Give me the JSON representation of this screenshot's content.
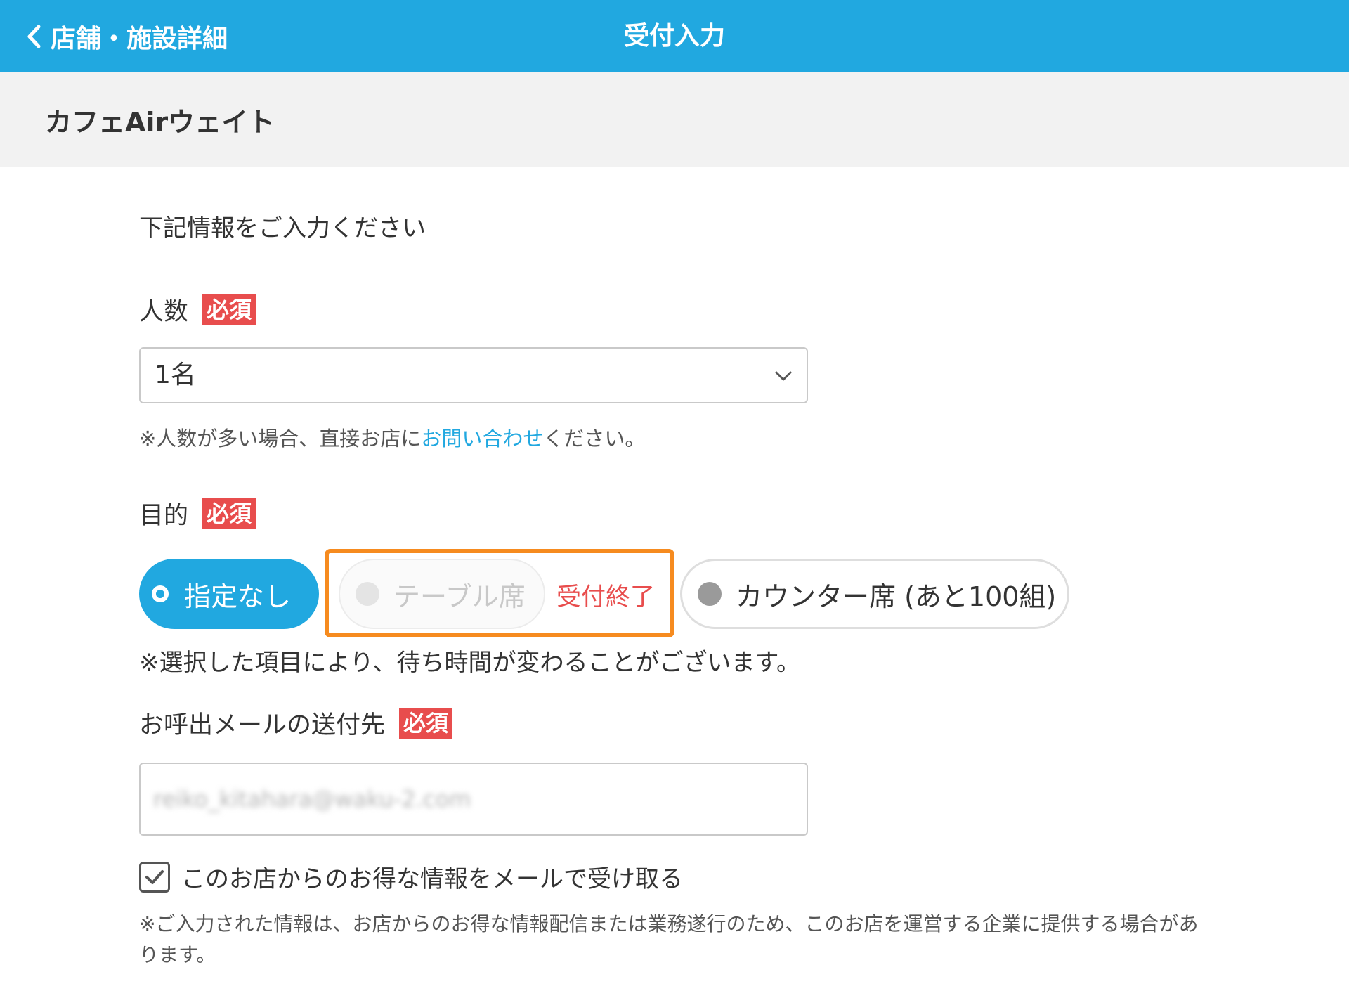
{
  "header": {
    "back_label": "店舗・施設詳細",
    "title": "受付入力"
  },
  "shop": {
    "name": "カフェAirウェイト"
  },
  "form": {
    "intro": "下記情報をご入力ください",
    "required_badge": "必須",
    "people": {
      "label": "人数",
      "value": "1名",
      "note_before": "※人数が多い場合、直接お店に",
      "note_link": "お問い合わせ",
      "note_after": "ください。"
    },
    "purpose": {
      "label": "目的",
      "options": [
        {
          "label": "指定なし",
          "state": "selected"
        },
        {
          "label": "テーブル席",
          "state": "disabled",
          "status": "受付終了"
        },
        {
          "label": "カウンター席 (あと100組)",
          "state": "available"
        }
      ],
      "note": "※選択した項目により、待ち時間が変わることがございます。"
    },
    "email": {
      "label": "お呼出メールの送付先",
      "value": "reiko_kitahara@waku-2.com"
    },
    "newsletter": {
      "label": "このお店からのお得な情報をメールで受け取る",
      "checked": true
    },
    "footnote": "※ご入力された情報は、お店からのお得な情報配信または業務遂行のため、このお店を運営する企業に提供する場合があります。"
  },
  "colors": {
    "header_bg": "#21a8e0",
    "required_bg": "#e84d4d",
    "highlight_border": "#f68b1f",
    "link": "#21a8e0"
  }
}
